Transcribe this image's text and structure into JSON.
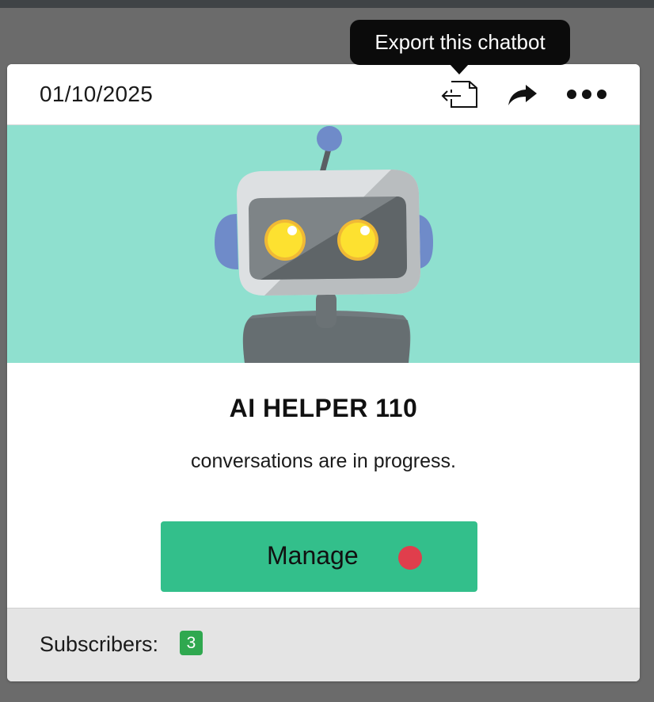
{
  "card": {
    "date": "01/10/2025",
    "title": "AI HELPER 110",
    "subtitle": "conversations are in progress.",
    "manage_label": "Manage",
    "subscribers_label": "Subscribers:",
    "subscribers_count": "3"
  },
  "tooltip": {
    "text": "Export this chatbot"
  },
  "icons": {
    "export": "export-icon",
    "share": "share-icon",
    "more": "more-dots-icon",
    "status": "status-dot-icon"
  },
  "colors": {
    "hero_bg": "#8fe0cf",
    "manage_button": "#33bf8b",
    "status_dot": "#e03e4c",
    "badge": "#2fa84f"
  }
}
